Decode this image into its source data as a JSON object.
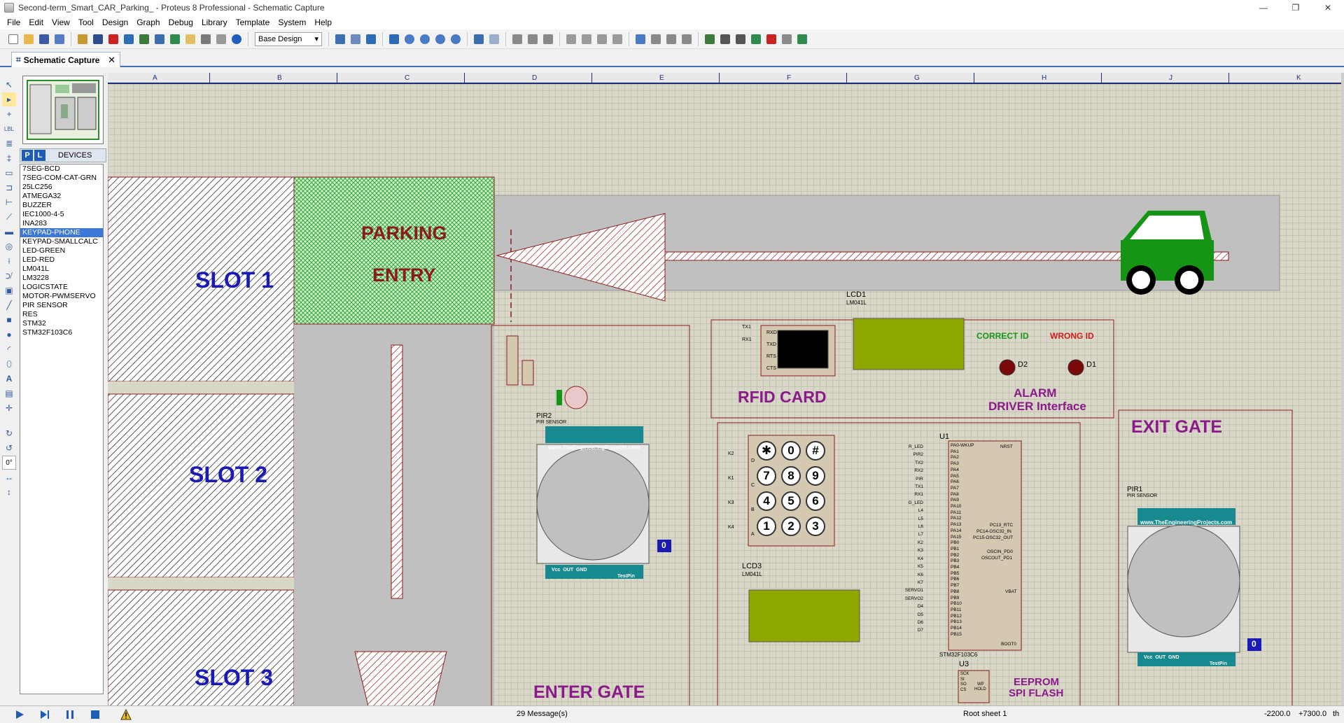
{
  "window": {
    "title": "Second-term_Smart_CAR_Parking_ - Proteus 8 Professional - Schematic Capture",
    "controls": [
      "—",
      "❐",
      "✕"
    ]
  },
  "menu": [
    "File",
    "Edit",
    "View",
    "Tool",
    "Design",
    "Graph",
    "Debug",
    "Library",
    "Template",
    "System",
    "Help"
  ],
  "toolbar": {
    "design_select": "Base Design"
  },
  "tab": {
    "label": "Schematic Capture",
    "close": "✕"
  },
  "left_panel": {
    "pick_p": "P",
    "pick_l": "L",
    "devices_label": "DEVICES",
    "devices": [
      "7SEG-BCD",
      "7SEG-COM-CAT-GRN",
      "25LC256",
      "ATMEGA32",
      "BUZZER",
      "IEC1000-4-5",
      "INA283",
      "KEYPAD-PHONE",
      "KEYPAD-SMALLCALC",
      "LED-GREEN",
      "LED-RED",
      "LM041L",
      "LM3228",
      "LOGICSTATE",
      "MOTOR-PWMSERVO",
      "PIR SENSOR",
      "RES",
      "STM32",
      "STM32F103C6"
    ],
    "selected_index": 7,
    "rotation": "0°"
  },
  "ruler": [
    "A",
    "B",
    "C",
    "D",
    "E",
    "F",
    "G",
    "H",
    "J",
    "K"
  ],
  "schematic": {
    "slot1": "SLOT 1",
    "slot2": "SLOT 2",
    "slot3": "SLOT 3",
    "parking": "PARKING",
    "entry": "ENTRY",
    "rfid": "RFID CARD",
    "alarm1": "ALARM",
    "alarm2": "DRIVER Interface",
    "exit_gate": "EXIT GATE",
    "enter_gate": "ENTER GATE",
    "eeprom1": "EEPROM",
    "eeprom2": "SPI FLASH",
    "correct_id": "CORRECT ID",
    "wrong_id": "WRONG ID",
    "lcd1": "LCD1",
    "lcd1_part": "LM041L",
    "lcd3": "LCD3",
    "lcd3_part": "LM041L",
    "u1": "U1",
    "u1_part": "STM32F103C6",
    "u3": "U3",
    "pir1": "PIR1",
    "pir2": "PIR2",
    "pir_part": "PIR SENSOR",
    "d1": "D1",
    "d2": "D2",
    "pir_site": "www.TheEngineeringProjects.com",
    "pir_pins": "Vcc  OUT  GND",
    "testpin": "TestPin",
    "logic0": "0",
    "rfid_pins": [
      "RXD",
      "TXD",
      "RTS",
      "CTS"
    ],
    "rfid_nets": [
      "TX1",
      "RX1"
    ],
    "keypad_rows": [
      "K2",
      "K1",
      "K3",
      "K4"
    ],
    "keypad_row_letters": [
      "D",
      "C",
      "B",
      "A"
    ],
    "keypad_keys": [
      "✱",
      "0",
      "#",
      "7",
      "8",
      "9",
      "4",
      "5",
      "6",
      "1",
      "2",
      "3"
    ],
    "u1_left_pins": [
      "PA0-WKUP",
      "PA1",
      "PA2",
      "PA3",
      "PA4",
      "PA5",
      "PA6",
      "PA7",
      "PA8",
      "PA9",
      "PA10",
      "PA11",
      "PA12",
      "PA13",
      "PA14",
      "PA15",
      "PB0",
      "PB1",
      "PB2",
      "PB3",
      "PB4",
      "PB5",
      "PB6",
      "PB7",
      "PB8",
      "PB9",
      "PB10",
      "PB11",
      "PB12",
      "PB13",
      "PB14",
      "PB15"
    ],
    "u1_right_pins": [
      "NRST",
      "PC13_RTC",
      "PC14-OSC32_IN",
      "PC15-OSC32_OUT",
      "OSCIN_PD0",
      "OSCOUT_PD1",
      "VBAT",
      "BOOT0"
    ],
    "u1_nets": [
      "R_LED",
      "PIR2",
      "TX2",
      "RX2",
      "PIR",
      "TX1",
      "RX1",
      "G_LED",
      "L4",
      "L5",
      "L6",
      "L7",
      "K2",
      "K3",
      "K4",
      "K5",
      "K6",
      "K7",
      "SERVO1",
      "SERVO2",
      "D4",
      "D5",
      "D6",
      "D7"
    ],
    "u3_pins": [
      "SCK",
      "SI",
      "SO",
      "CS",
      "WP",
      "HOLD"
    ]
  },
  "status": {
    "messages": "29 Message(s)",
    "sheet": "Root sheet 1",
    "x": "-2200.0",
    "y": "+7300.0",
    "unit": "th"
  },
  "colors": {
    "label_blue": "#1a1ab4",
    "label_maroon": "#8b1a1a",
    "label_purple": "#8a1a8a",
    "car_green": "#169416",
    "lcd_green": "#8fa800"
  }
}
